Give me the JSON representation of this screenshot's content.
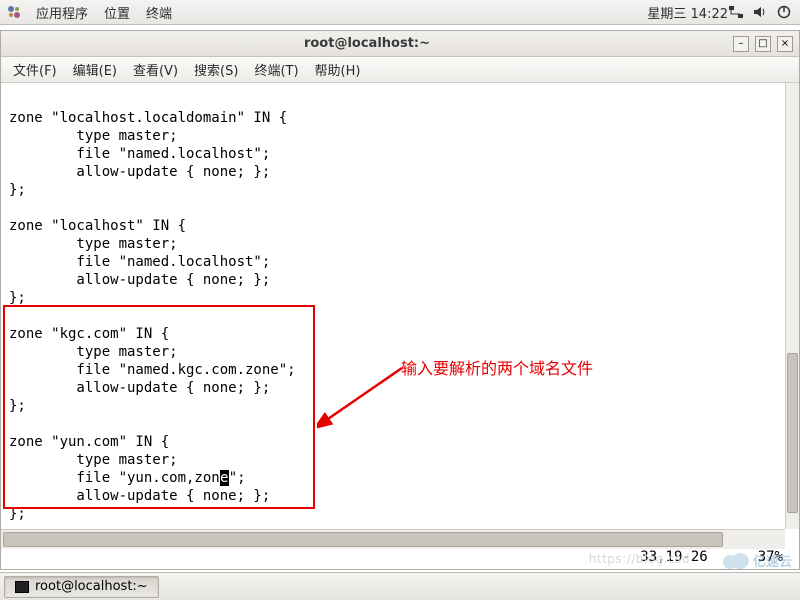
{
  "panel": {
    "apps": "应用程序",
    "places": "位置",
    "terminal": "终端",
    "clock": "星期三 14:22"
  },
  "window": {
    "title": "root@localhost:~"
  },
  "menubar": {
    "file": "文件(F)",
    "edit": "编辑(E)",
    "view": "查看(V)",
    "search": "搜索(S)",
    "terminal": "终端(T)",
    "help": "帮助(H)"
  },
  "terminal": {
    "line01": "zone \"localhost.localdomain\" IN {",
    "line02": "        type master;",
    "line03": "        file \"named.localhost\";",
    "line04": "        allow-update { none; };",
    "line05": "};",
    "line06": "",
    "line07": "zone \"localhost\" IN {",
    "line08": "        type master;",
    "line09": "        file \"named.localhost\";",
    "line10": "        allow-update { none; };",
    "line11": "};",
    "line12": "",
    "line13": "zone \"kgc.com\" IN {",
    "line14": "        type master;",
    "line15": "        file \"named.kgc.com.zone\";",
    "line16": "        allow-update { none; };",
    "line17": "};",
    "line18": "",
    "line19": "zone \"yun.com\" IN {",
    "line20": "        type master;",
    "line21a": "        file \"yun.com,zon",
    "line21b": "e",
    "line21c": "\";",
    "line22": "        allow-update { none; };",
    "line23": "};"
  },
  "annotation": {
    "text": "输入要解析的两个域名文件"
  },
  "status": {
    "pos": "33,19-26",
    "pct": "37%"
  },
  "taskbar": {
    "task1": "root@localhost:~"
  },
  "watermark": {
    "url": "https://blog.csd",
    "brand": "亿速云"
  }
}
